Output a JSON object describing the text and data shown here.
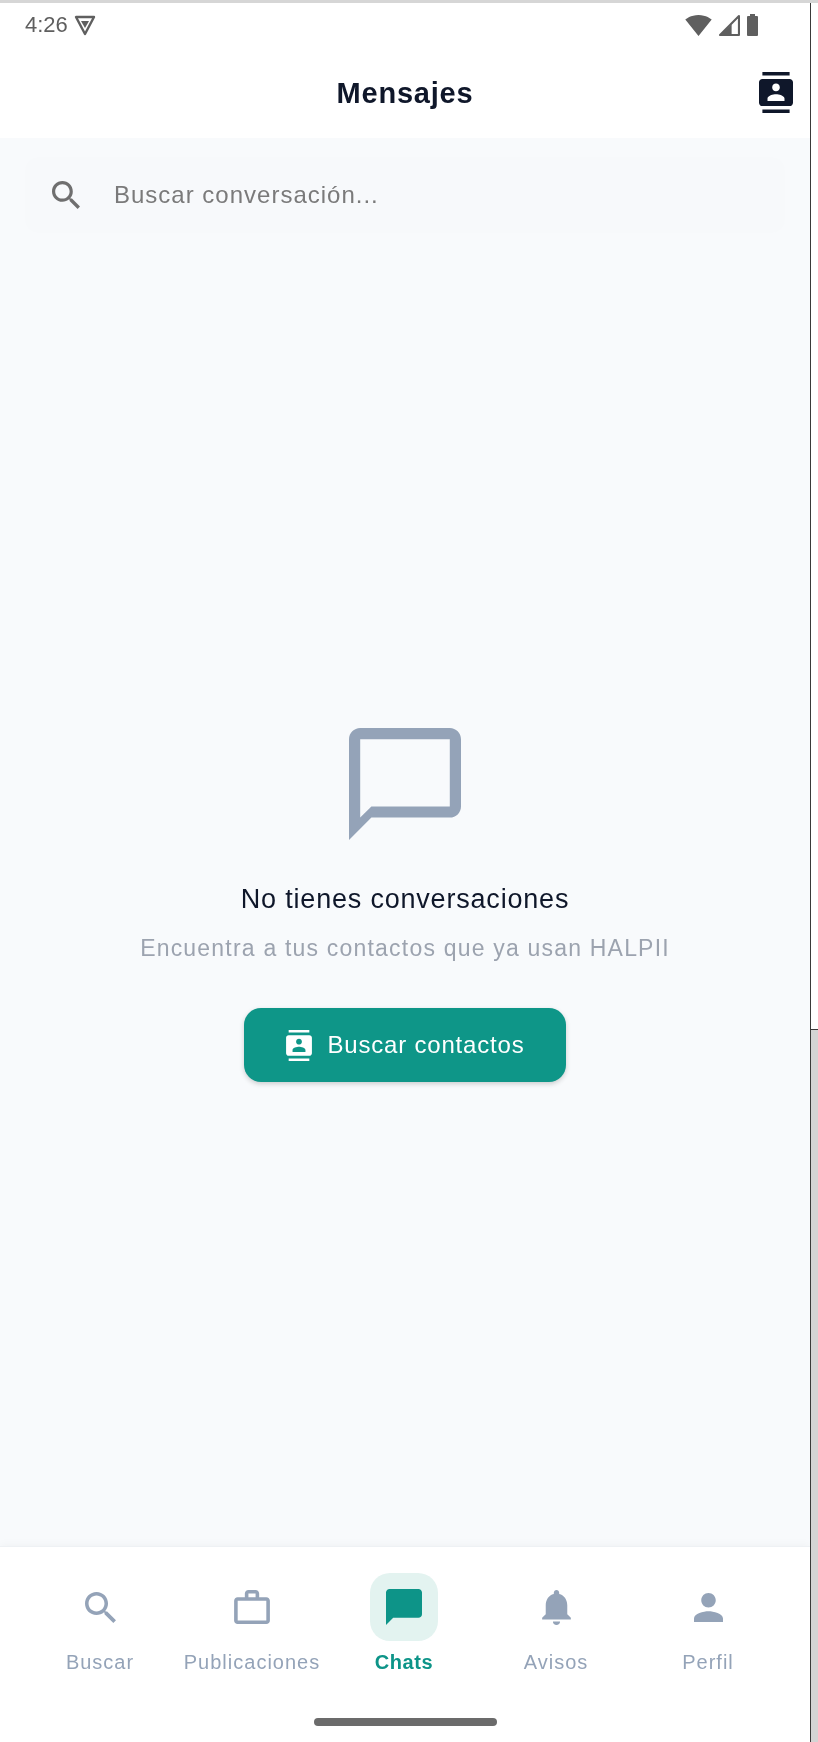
{
  "status_bar": {
    "time": "4:26"
  },
  "header": {
    "title": "Mensajes"
  },
  "search": {
    "placeholder": "Buscar conversación..."
  },
  "empty_state": {
    "title": "No tienes conversaciones",
    "subtitle": "Encuentra a tus contactos que ya usan HALPII",
    "button": "Buscar contactos"
  },
  "bottom_nav": [
    {
      "label": "Buscar",
      "kind": "search",
      "selected": false
    },
    {
      "label": "Publicaciones",
      "kind": "briefcase",
      "selected": false
    },
    {
      "label": "Chats",
      "kind": "chat",
      "selected": true
    },
    {
      "label": "Avisos",
      "kind": "bell",
      "selected": false
    },
    {
      "label": "Perfil",
      "kind": "person",
      "selected": false
    }
  ]
}
